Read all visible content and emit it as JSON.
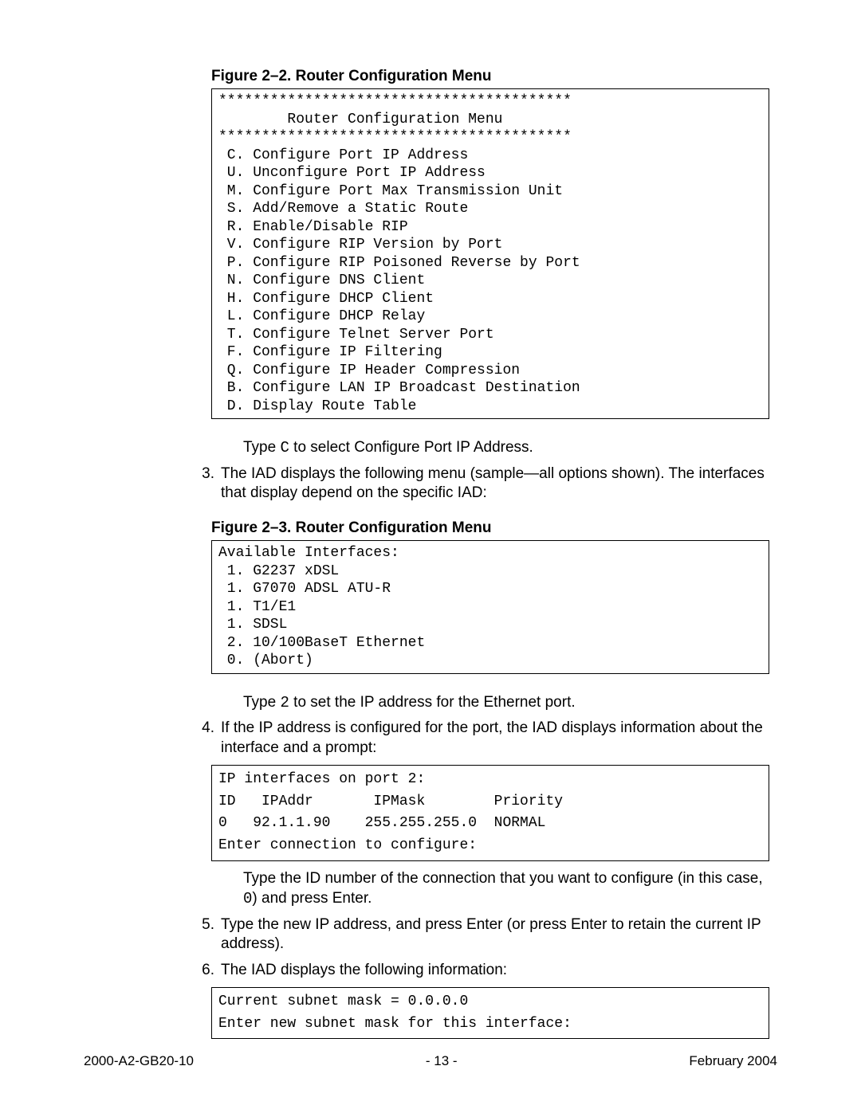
{
  "fig22_caption": "Figure 2–2.  Router Configuration Menu",
  "menu1_hr": "*****************************************",
  "menu1_title": "        Router Configuration Menu",
  "menu1_items": [
    " C. Configure Port IP Address",
    " U. Unconfigure Port IP Address",
    " M. Configure Port Max Transmission Unit",
    " S. Add/Remove a Static Route",
    " R. Enable/Disable RIP",
    " V. Configure RIP Version by Port",
    " P. Configure RIP Poisoned Reverse by Port",
    " N. Configure DNS Client",
    " H. Configure DHCP Client",
    " L. Configure DHCP Relay",
    " T. Configure Telnet Server Port",
    " F. Configure IP Filtering",
    " Q. Configure IP Header Compression",
    " B. Configure LAN IP Broadcast Destination",
    " D. Display Route Table"
  ],
  "text_type_c_pre": "Type ",
  "text_type_c_code": "C",
  "text_type_c_post": " to select Configure Port IP Address.",
  "step3_num": "3.",
  "step3_text": "The IAD displays the following menu (sample—all options shown). The interfaces that display depend on the specific IAD:",
  "fig23_caption": "Figure 2–3.  Router Configuration Menu",
  "menu2_header": "Available Interfaces:",
  "menu2_items": [
    " 1. G2237 xDSL",
    " 1. G7070 ADSL ATU-R",
    " 1. T1/E1",
    " 1. SDSL",
    " 2. 10/100BaseT Ethernet",
    " 0. (Abort)"
  ],
  "text_type_2_pre": "Type ",
  "text_type_2_code": "2",
  "text_type_2_post": " to set the IP address for the Ethernet port.",
  "step4_num": "4.",
  "step4_text": "If the IP address is configured for the port, the IAD displays information about the interface and a prompt:",
  "box3_l1": "IP interfaces on port 2:",
  "box3_l2": "ID   IPAddr       IPMask        Priority",
  "box3_l3": "0   92.1.1.90    255.255.255.0  NORMAL",
  "box3_l4": "Enter connection to configure:",
  "text_type_id_pre": "Type the ID number of the connection that you want to configure (in this case, ",
  "text_type_id_code": "0",
  "text_type_id_post": ") and press Enter.",
  "step5_num": "5.",
  "step5_text": "Type the new IP address, and press Enter (or press Enter to retain the current IP address).",
  "step6_num": "6.",
  "step6_text": "The IAD displays the following information:",
  "box4_l1": "Current subnet mask = 0.0.0.0",
  "box4_l2": "Enter new subnet mask for this interface:",
  "footer_left": "2000-A2-GB20-10",
  "footer_center": "- 13 -",
  "footer_right": "February 2004"
}
